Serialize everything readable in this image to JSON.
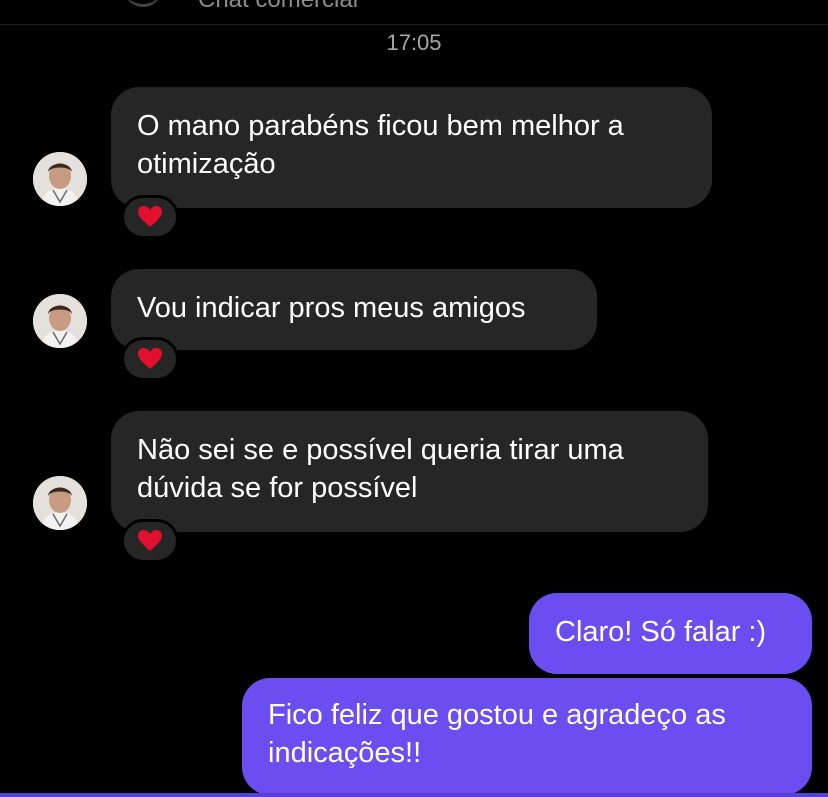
{
  "header": {
    "partial_title": "Chat comercial"
  },
  "timestamp": "17:05",
  "messages": {
    "incoming": [
      {
        "text": "O mano parabéns ficou bem melhor a otimização",
        "reaction": "heart-icon"
      },
      {
        "text": "Vou indicar pros meus amigos",
        "reaction": "heart-icon"
      },
      {
        "text": "Não sei se e possível queria tirar uma dúvida se for possível",
        "reaction": "heart-icon"
      }
    ],
    "outgoing": [
      {
        "text": "Claro! Só falar :)"
      },
      {
        "text": "Fico feliz que gostou e agradeço as indicações!!"
      }
    ]
  },
  "colors": {
    "background": "#000000",
    "incoming_bubble": "#262626",
    "outgoing_bubble": "#6b4ef0",
    "timestamp_text": "#a7a7a7",
    "heart": "#e0102e"
  }
}
